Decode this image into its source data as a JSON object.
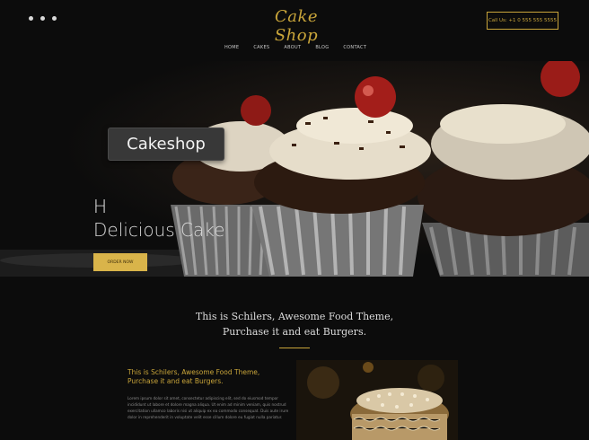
{
  "header": {
    "logo": "Cake Shop",
    "call_button": "Call Us: +1 0 555 555 5555",
    "social_icons": [
      "facebook-icon",
      "twitter-icon",
      "instagram-icon"
    ],
    "nav": [
      "HOME",
      "CAKES",
      "ABOUT",
      "BLOG",
      "CONTACT"
    ]
  },
  "hero": {
    "title_line1": "H",
    "title_line2": "Delicious Cake",
    "button": "ORDER NOW"
  },
  "tooltip": "Cakeshop",
  "section": {
    "title_line1": "This is Schilers, Awesome Food Theme,",
    "title_line2": "Purchase it and eat Burgers.",
    "sub_title_line1": "This is Schilers, Awesome Food Theme,",
    "sub_title_line2": "Purchase it and eat Burgers.",
    "paragraph": "Lorem ipsum dolor sit amet, consectetur adipiscing elit, sed do eiusmod tempor incididunt ut labore et dolore magna aliqua. Ut enim ad minim veniam, quis nostrud exercitation ullamco laboris nisi ut aliquip ex ea commodo consequat. Duis aute irure dolor in reprehenderit in voluptate velit esse cillum dolore eu fugiat nulla pariatur."
  },
  "colors": {
    "accent": "#c9a53a",
    "background": "#0c0c0c",
    "button": "#d9b44a"
  }
}
